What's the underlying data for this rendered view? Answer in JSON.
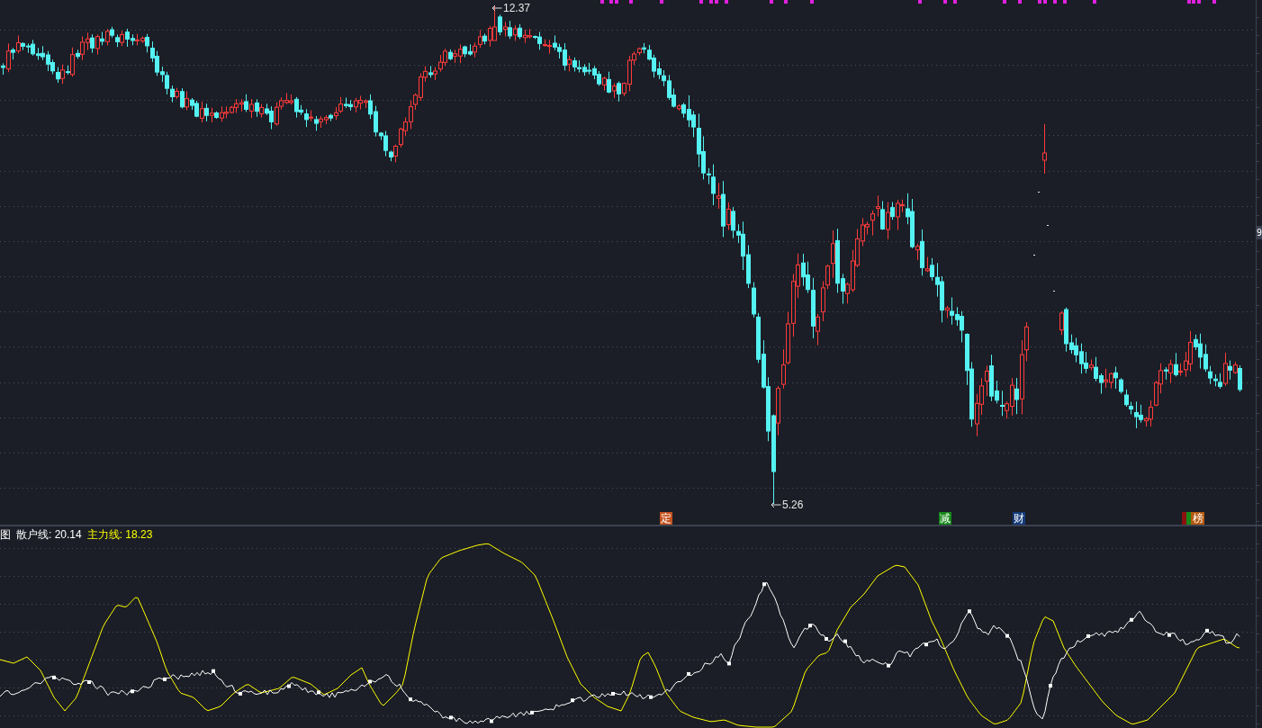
{
  "price_chart": {
    "price_marks": [
      {
        "kind": "high",
        "value": "12.37"
      },
      {
        "kind": "low",
        "value": "5.26"
      }
    ],
    "events": [
      {
        "kind": "badge",
        "label": "定",
        "color": "#c4521e"
      },
      {
        "kind": "badge",
        "label": "减",
        "color": "#17891a"
      },
      {
        "kind": "badge",
        "label": "财",
        "color": "#143a7a"
      },
      {
        "kind": "stub",
        "color": "#8c1010"
      },
      {
        "kind": "stub",
        "color": "#17891a"
      },
      {
        "kind": "badge",
        "label": "榜",
        "color": "#b4580e"
      }
    ]
  },
  "price_axis": {
    "label": "9"
  },
  "indicator": {
    "title": "图",
    "series": [
      {
        "label": "散户线: 20.14",
        "color": "#ffffff"
      },
      {
        "label": "主力线: 18.23",
        "color": "#ffff00"
      }
    ]
  }
}
